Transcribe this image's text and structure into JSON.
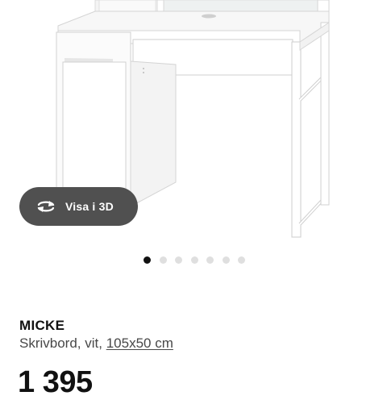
{
  "gallery": {
    "view_3d_label": "Visa i 3D",
    "total_images": 7,
    "active_index": 0
  },
  "product": {
    "name": "MICKE",
    "description": "Skrivbord, vit,",
    "size": "105x50 cm",
    "price": "1 395"
  },
  "icons": [
    "rotate-3d-icon"
  ],
  "colors": {
    "button_bg": "#505050",
    "dot_active": "#111111",
    "dot_inactive": "#dfdfdf"
  }
}
